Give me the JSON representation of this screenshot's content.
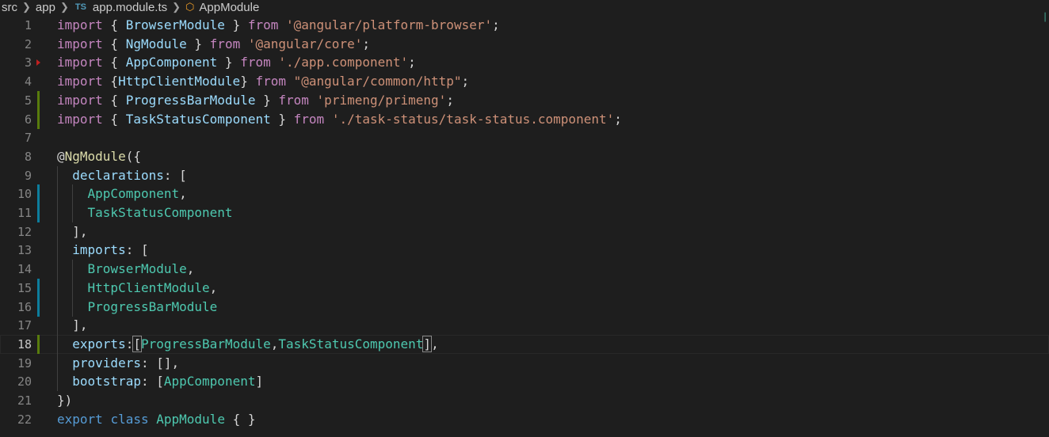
{
  "breadcrumb": {
    "items": [
      "src",
      "app",
      "app.module.ts",
      "AppModule"
    ],
    "file_type_badge": "TS"
  },
  "editor": {
    "file": "app.module.ts",
    "language": "typescript",
    "current_line": 18,
    "lines": [
      {
        "n": "1",
        "gutter": "none",
        "tokens": [
          [
            "kw",
            "import"
          ],
          [
            "pu",
            " { "
          ],
          [
            "va",
            "BrowserModule"
          ],
          [
            "pu",
            " } "
          ],
          [
            "kw",
            "from"
          ],
          [
            "pu",
            " "
          ],
          [
            "st",
            "'@angular/platform-browser'"
          ],
          [
            "pu",
            ";"
          ]
        ]
      },
      {
        "n": "2",
        "gutter": "none",
        "tokens": [
          [
            "kw",
            "import"
          ],
          [
            "pu",
            " { "
          ],
          [
            "va",
            "NgModule"
          ],
          [
            "pu",
            " } "
          ],
          [
            "kw",
            "from"
          ],
          [
            "pu",
            " "
          ],
          [
            "st",
            "'@angular/core'"
          ],
          [
            "pu",
            ";"
          ]
        ]
      },
      {
        "n": "3",
        "gutter": "deleted",
        "tokens": [
          [
            "kw",
            "import"
          ],
          [
            "pu",
            " { "
          ],
          [
            "va",
            "AppComponent"
          ],
          [
            "pu",
            " } "
          ],
          [
            "kw",
            "from"
          ],
          [
            "pu",
            " "
          ],
          [
            "st",
            "'./app.component'"
          ],
          [
            "pu",
            ";"
          ]
        ]
      },
      {
        "n": "4",
        "gutter": "none",
        "tokens": [
          [
            "kw",
            "import"
          ],
          [
            "pu",
            " {"
          ],
          [
            "va",
            "HttpClientModule"
          ],
          [
            "pu",
            "} "
          ],
          [
            "kw",
            "from"
          ],
          [
            "pu",
            " "
          ],
          [
            "st",
            "\"@angular/common/http\""
          ],
          [
            "pu",
            ";"
          ]
        ]
      },
      {
        "n": "5",
        "gutter": "added",
        "tokens": [
          [
            "kw",
            "import"
          ],
          [
            "pu",
            " { "
          ],
          [
            "va",
            "ProgressBarModule"
          ],
          [
            "pu",
            " } "
          ],
          [
            "kw",
            "from"
          ],
          [
            "pu",
            " "
          ],
          [
            "st",
            "'primeng/primeng'"
          ],
          [
            "pu",
            ";"
          ]
        ]
      },
      {
        "n": "6",
        "gutter": "added",
        "tokens": [
          [
            "kw",
            "import"
          ],
          [
            "pu",
            " { "
          ],
          [
            "va",
            "TaskStatusComponent"
          ],
          [
            "pu",
            " } "
          ],
          [
            "kw",
            "from"
          ],
          [
            "pu",
            " "
          ],
          [
            "st",
            "'./task-status/task-status.component'"
          ],
          [
            "pu",
            ";"
          ]
        ]
      },
      {
        "n": "7",
        "gutter": "none",
        "tokens": []
      },
      {
        "n": "8",
        "gutter": "none",
        "tokens": [
          [
            "pu",
            "@"
          ],
          [
            "dec",
            "NgModule"
          ],
          [
            "pu",
            "({"
          ]
        ]
      },
      {
        "n": "9",
        "gutter": "none",
        "tokens": [
          [
            "pu",
            "  "
          ],
          [
            "va",
            "declarations"
          ],
          [
            "pu",
            ": ["
          ]
        ]
      },
      {
        "n": "10",
        "gutter": "modified",
        "tokens": [
          [
            "pu",
            "    "
          ],
          [
            "ty",
            "AppComponent"
          ],
          [
            "pu",
            ","
          ]
        ]
      },
      {
        "n": "11",
        "gutter": "modified",
        "tokens": [
          [
            "pu",
            "    "
          ],
          [
            "ty",
            "TaskStatusComponent"
          ]
        ]
      },
      {
        "n": "12",
        "gutter": "none",
        "tokens": [
          [
            "pu",
            "  ],"
          ]
        ]
      },
      {
        "n": "13",
        "gutter": "none",
        "tokens": [
          [
            "pu",
            "  "
          ],
          [
            "va",
            "imports"
          ],
          [
            "pu",
            ": ["
          ]
        ]
      },
      {
        "n": "14",
        "gutter": "none",
        "tokens": [
          [
            "pu",
            "    "
          ],
          [
            "ty",
            "BrowserModule"
          ],
          [
            "pu",
            ","
          ]
        ]
      },
      {
        "n": "15",
        "gutter": "modified",
        "tokens": [
          [
            "pu",
            "    "
          ],
          [
            "ty",
            "HttpClientModule"
          ],
          [
            "pu",
            ","
          ]
        ]
      },
      {
        "n": "16",
        "gutter": "modified",
        "tokens": [
          [
            "pu",
            "    "
          ],
          [
            "ty",
            "ProgressBarModule"
          ]
        ]
      },
      {
        "n": "17",
        "gutter": "none",
        "tokens": [
          [
            "pu",
            "  ],"
          ]
        ]
      },
      {
        "n": "18",
        "gutter": "added",
        "tokens": [
          [
            "pu",
            "  "
          ],
          [
            "va",
            "exports"
          ],
          [
            "pu",
            ":"
          ],
          [
            "bm",
            "["
          ],
          [
            "ty",
            "ProgressBarModule"
          ],
          [
            "pu",
            ","
          ],
          [
            "ty",
            "TaskStatusComponent"
          ],
          [
            "bm",
            "]"
          ],
          [
            "pu",
            ","
          ]
        ]
      },
      {
        "n": "19",
        "gutter": "none",
        "tokens": [
          [
            "pu",
            "  "
          ],
          [
            "va",
            "providers"
          ],
          [
            "pu",
            ": [],"
          ]
        ]
      },
      {
        "n": "20",
        "gutter": "none",
        "tokens": [
          [
            "pu",
            "  "
          ],
          [
            "va",
            "bootstrap"
          ],
          [
            "pu",
            ": ["
          ],
          [
            "ty",
            "AppComponent"
          ],
          [
            "pu",
            "]"
          ]
        ]
      },
      {
        "n": "21",
        "gutter": "none",
        "tokens": [
          [
            "pu",
            "})"
          ]
        ]
      },
      {
        "n": "22",
        "gutter": "none",
        "tokens": [
          [
            "kw2",
            "export"
          ],
          [
            "pu",
            " "
          ],
          [
            "kw2",
            "class"
          ],
          [
            "pu",
            " "
          ],
          [
            "ty",
            "AppModule"
          ],
          [
            "pu",
            " { }"
          ]
        ]
      }
    ]
  },
  "colors": {
    "background": "#1e1e1e",
    "keyword": "#c586c0",
    "storage": "#569cd6",
    "type": "#4ec9b0",
    "variable": "#9cdcfe",
    "string": "#ce9178",
    "decorator": "#dcdcaa",
    "line_number": "#858585",
    "gutter_added": "#587c0c",
    "gutter_modified": "#0c7d9d"
  }
}
